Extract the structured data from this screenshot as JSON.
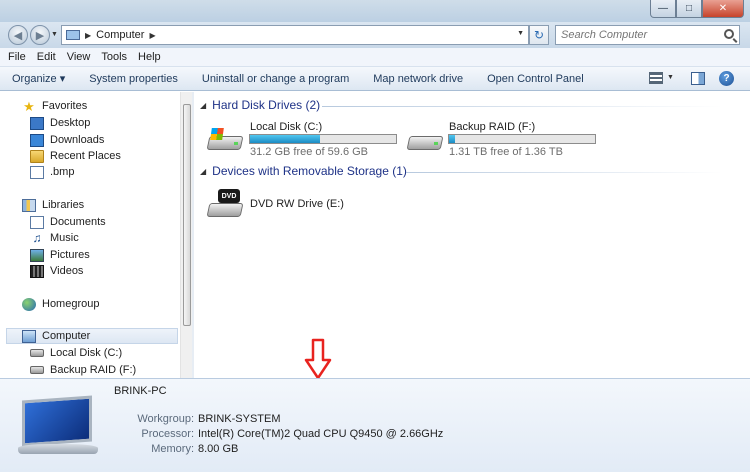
{
  "window": {
    "minimize_glyph": "—",
    "maximize_glyph": "□",
    "close_glyph": "✕"
  },
  "navigation": {
    "back_glyph": "◀",
    "forward_glyph": "▶",
    "breadcrumb": [
      "Computer"
    ],
    "search_placeholder": "Search Computer",
    "refresh_glyph": "↻"
  },
  "menu": [
    "File",
    "Edit",
    "View",
    "Tools",
    "Help"
  ],
  "commands": {
    "organize": "Organize ▾",
    "items": [
      "System properties",
      "Uninstall or change a program",
      "Map network drive",
      "Open Control Panel"
    ]
  },
  "help_glyph": "?",
  "sidebar": {
    "favorites": {
      "label": "Favorites",
      "items": [
        "Desktop",
        "Downloads",
        "Recent Places",
        ".bmp"
      ]
    },
    "libraries": {
      "label": "Libraries",
      "items": [
        "Documents",
        "Music",
        "Pictures",
        "Videos"
      ]
    },
    "homegroup": "Homegroup",
    "computer": {
      "label": "Computer",
      "items": [
        "Local Disk (C:)",
        "Backup RAID (F:)"
      ]
    }
  },
  "groups": {
    "hard_disks": "Hard Disk Drives (2)",
    "removable": "Devices with Removable Storage (1)"
  },
  "drives": [
    {
      "name": "Local Disk (C:)",
      "free": "31.2 GB free of 59.6 GB",
      "used_fraction": 0.48
    },
    {
      "name": "Backup RAID (F:)",
      "free": "1.31 TB free of 1.36 TB",
      "used_fraction": 0.04
    }
  ],
  "dvd": {
    "name": "DVD RW Drive (E:)",
    "badge": "DVD"
  },
  "details": {
    "computer_name": "BRINK-PC",
    "rows": [
      {
        "key": "Workgroup:",
        "value": "BRINK-SYSTEM"
      },
      {
        "key": "Processor:",
        "value": "Intel(R) Core(TM)2 Quad  CPU   Q9450  @ 2.66GHz"
      },
      {
        "key": "Memory:",
        "value": "8.00 GB"
      }
    ]
  },
  "colors": {
    "annotation_arrow": "#e8231f",
    "group_header": "#1e3287",
    "capacity_bar": "#26a0da"
  }
}
